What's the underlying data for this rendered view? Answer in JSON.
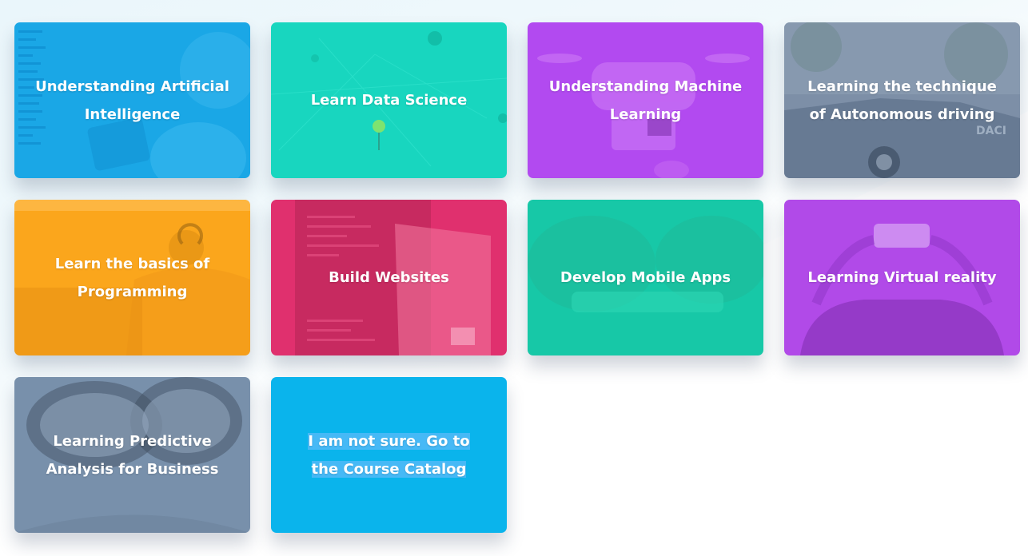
{
  "courses": [
    {
      "label": "Understanding Artificial Intelligence",
      "color": "#1aa7e6"
    },
    {
      "label": "Learn Data Science",
      "color": "#18d6bf"
    },
    {
      "label": "Understanding Machine Learning",
      "color": "#b24af0"
    },
    {
      "label": "Learning the technique of Autonomous driving",
      "color": "#7d8fa7"
    },
    {
      "label": "Learn the basics of Programming",
      "color": "#fba61c"
    },
    {
      "label": "Build Websites",
      "color": "#e0306e"
    },
    {
      "label": "Develop Mobile Apps",
      "color": "#17c8a7"
    },
    {
      "label": "Learning Virtual reality",
      "color": "#b14ae8"
    },
    {
      "label": "Learning Predictive Analysis for Business",
      "color": "#7890ab"
    }
  ],
  "catalog": {
    "line1": "I am not sure. Go to",
    "line2": "the Course Catalog",
    "color": "#0ab4ec"
  }
}
